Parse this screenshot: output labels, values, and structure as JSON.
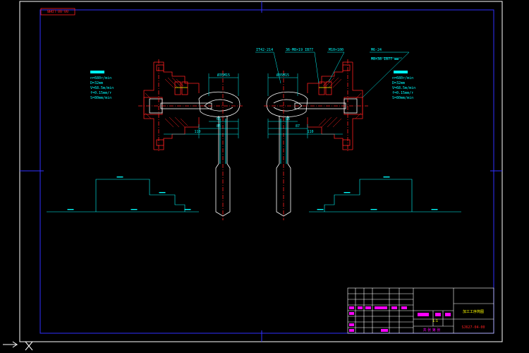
{
  "drawing": {
    "flipped_stamp": "00-00-LDHB",
    "left_notes_title": "▬▬▬▬▬",
    "left_notes": [
      "n=680r/min",
      "D=32mm",
      "V=68.5m/min",
      "f=0.15mm/r",
      "S=80mm/min"
    ],
    "right_notes_title": "▬▬▬▬▬",
    "right_notes": [
      "n=680r/min",
      "D=32mm",
      "V=68.5m/min",
      "f=0.15mm/r",
      "S=80mm/min"
    ],
    "callouts": {
      "c1": "IT42-214",
      "c2": "36-M8×19 IB77",
      "c3": "M10×100",
      "c4": "M6-24",
      "c5": "M8×38 IB77 ▬▬"
    },
    "dims_left": {
      "top": "Ø35M15",
      "d1": "65",
      "d2": "85",
      "d3": "110"
    },
    "dims_right": {
      "top": "Ø35M15",
      "d1": "65",
      "d2": "87",
      "d3": "110"
    },
    "cycle_left": {
      "l1": "▬▬▬",
      "l2": "▬▬▬",
      "l3": "▬▬▬",
      "l4": "▬▬▬",
      "l5": "▬▬▬"
    },
    "cycle_right": {
      "l1": "▬▬▬",
      "l2": "▬▬▬",
      "l3": "▬▬▬",
      "l4": "▬▬▬",
      "l5": "▬▬▬"
    }
  },
  "title_block": {
    "drawing_title": "加工工序简图",
    "drawing_number": "SJ627-04-00",
    "scale": "1:1",
    "sheet": "共  张  第  张"
  }
}
